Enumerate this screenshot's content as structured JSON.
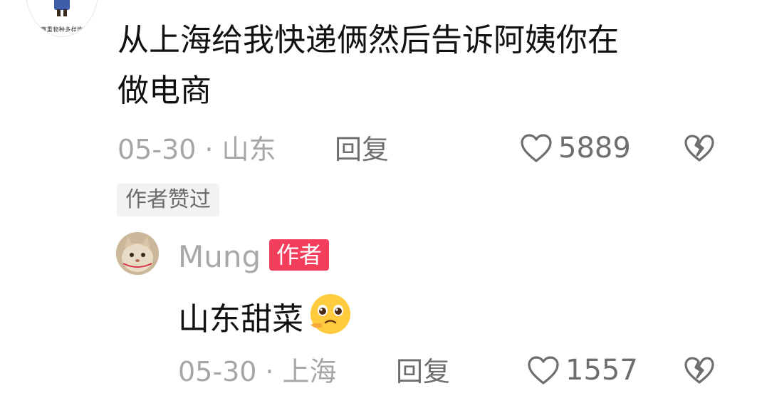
{
  "top_comment": {
    "avatar_caption": "尊重物种多样性",
    "text_line1": "从上海给我快递俩然后告诉阿姨你在",
    "text_line2": "做电商",
    "date": "05-30",
    "separator": "·",
    "location": "山东",
    "reply_label": "回复",
    "like_count": "5889",
    "author_liked_tag": "作者赞过"
  },
  "reply_comment": {
    "username": "Mung",
    "author_badge": "作者",
    "text": "山东甜菜",
    "emoji": "pleading-face-emoji",
    "date": "05-30",
    "separator": "·",
    "location": "上海",
    "reply_label": "回复",
    "like_count": "1557"
  },
  "colors": {
    "text": "#111111",
    "meta": "#a6a6a6",
    "secondary": "#6e6e6e",
    "badge": "#f23d5b",
    "tag_bg": "#f2f2f2"
  }
}
